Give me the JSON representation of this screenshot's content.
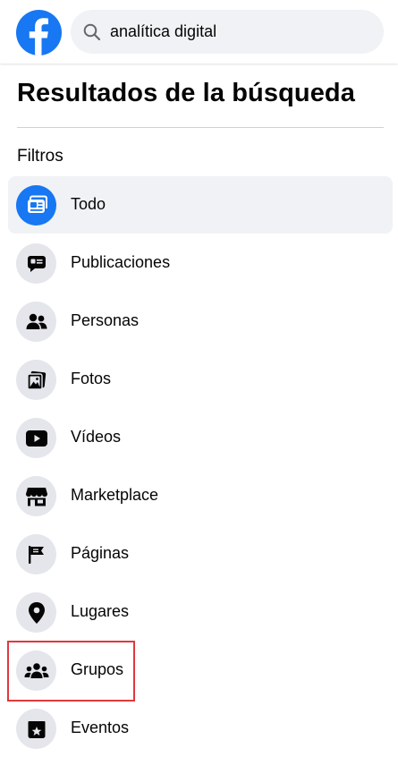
{
  "header": {
    "logo_icon": "facebook-logo-icon",
    "search": {
      "icon": "search-icon",
      "query": "analítica digital"
    }
  },
  "page": {
    "title": "Resultados de la búsqueda",
    "filters_label": "Filtros"
  },
  "filters": [
    {
      "label": "Todo",
      "icon": "newsfeed-icon",
      "active": true
    },
    {
      "label": "Publicaciones",
      "icon": "post-bubble-icon",
      "active": false
    },
    {
      "label": "Personas",
      "icon": "people-icon",
      "active": false
    },
    {
      "label": "Fotos",
      "icon": "photos-icon",
      "active": false
    },
    {
      "label": "Vídeos",
      "icon": "video-play-icon",
      "active": false
    },
    {
      "label": "Marketplace",
      "icon": "storefront-icon",
      "active": false
    },
    {
      "label": "Páginas",
      "icon": "flag-icon",
      "active": false
    },
    {
      "label": "Lugares",
      "icon": "location-pin-icon",
      "active": false
    },
    {
      "label": "Grupos",
      "icon": "groups-icon",
      "active": false
    },
    {
      "label": "Eventos",
      "icon": "event-star-icon",
      "active": false
    }
  ],
  "colors": {
    "brand": "#1877f2",
    "highlight_box": "#e0383e"
  }
}
